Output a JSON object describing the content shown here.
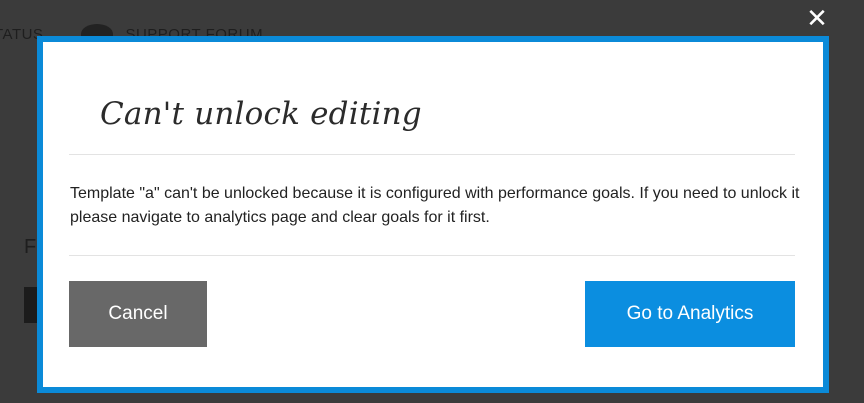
{
  "background": {
    "nav_status": "TATUS",
    "nav_forum": "SUPPORT FORUM",
    "partial_letter": "F"
  },
  "modal": {
    "close_glyph": "✕",
    "title": "Can't unlock editing",
    "message": "Template \"a\" can't be unlocked because it is configured with performance goals. If you need to unlock it please navigate to analytics page and clear goals for it first.",
    "cancel_label": "Cancel",
    "primary_label": "Go to Analytics"
  },
  "colors": {
    "accent": "#0b8ad8",
    "primary_button": "#0b8ee0",
    "secondary_button": "#686868",
    "overlay": "#3b3b3b"
  },
  "icons": {
    "close": "close-icon",
    "forum": "graduation-cap-icon"
  }
}
